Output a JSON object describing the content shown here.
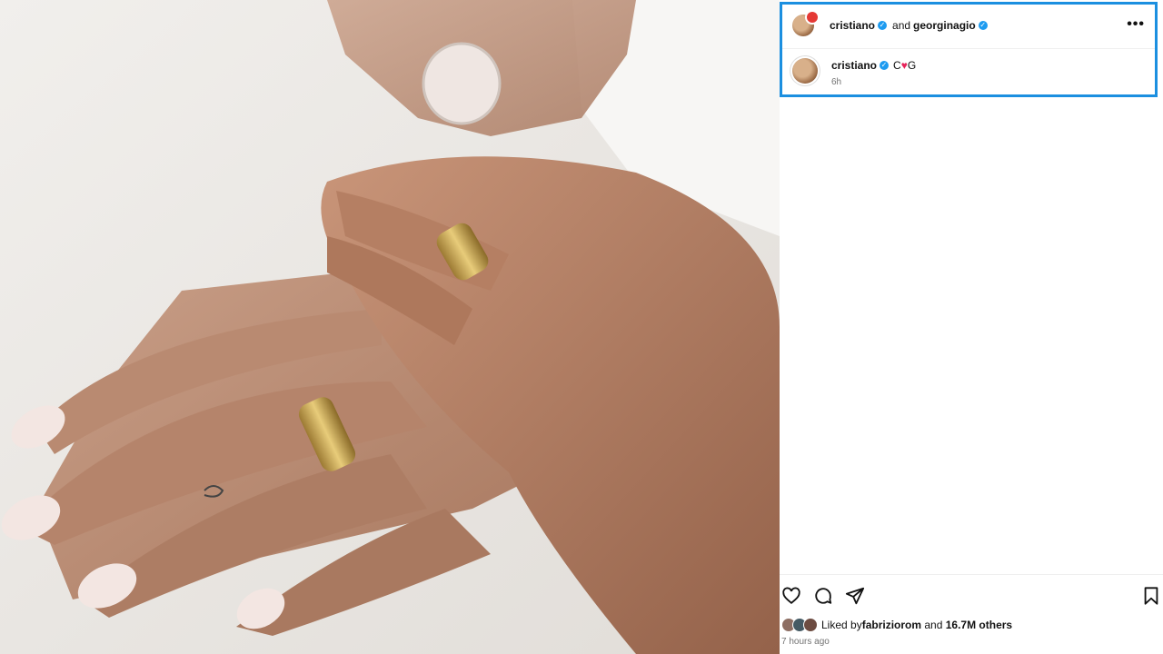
{
  "photo": {
    "description_icon": "wedding-rings-photo"
  },
  "post": {
    "header": {
      "user1": "cristiano",
      "joiner": "and",
      "user2": "georginagio",
      "more_icon": "ellipsis-icon",
      "more_glyph": "•••"
    },
    "caption": {
      "username": "cristiano",
      "text_before": "C",
      "heart": "♥",
      "text_after": "G",
      "time": "6h"
    },
    "actions": {
      "like_icon": "heart-outline-icon",
      "comment_icon": "comment-icon",
      "share_icon": "send-icon",
      "save_icon": "bookmark-icon"
    },
    "likes": {
      "prefix": "Liked by",
      "user": "fabriziorom",
      "middle": " and ",
      "count": "16.7M others"
    },
    "posted_ago": "7 hours ago"
  },
  "colors": {
    "highlight": "#1b8fe0",
    "verified": "#1d9bf0",
    "heart": "#e6235a"
  }
}
